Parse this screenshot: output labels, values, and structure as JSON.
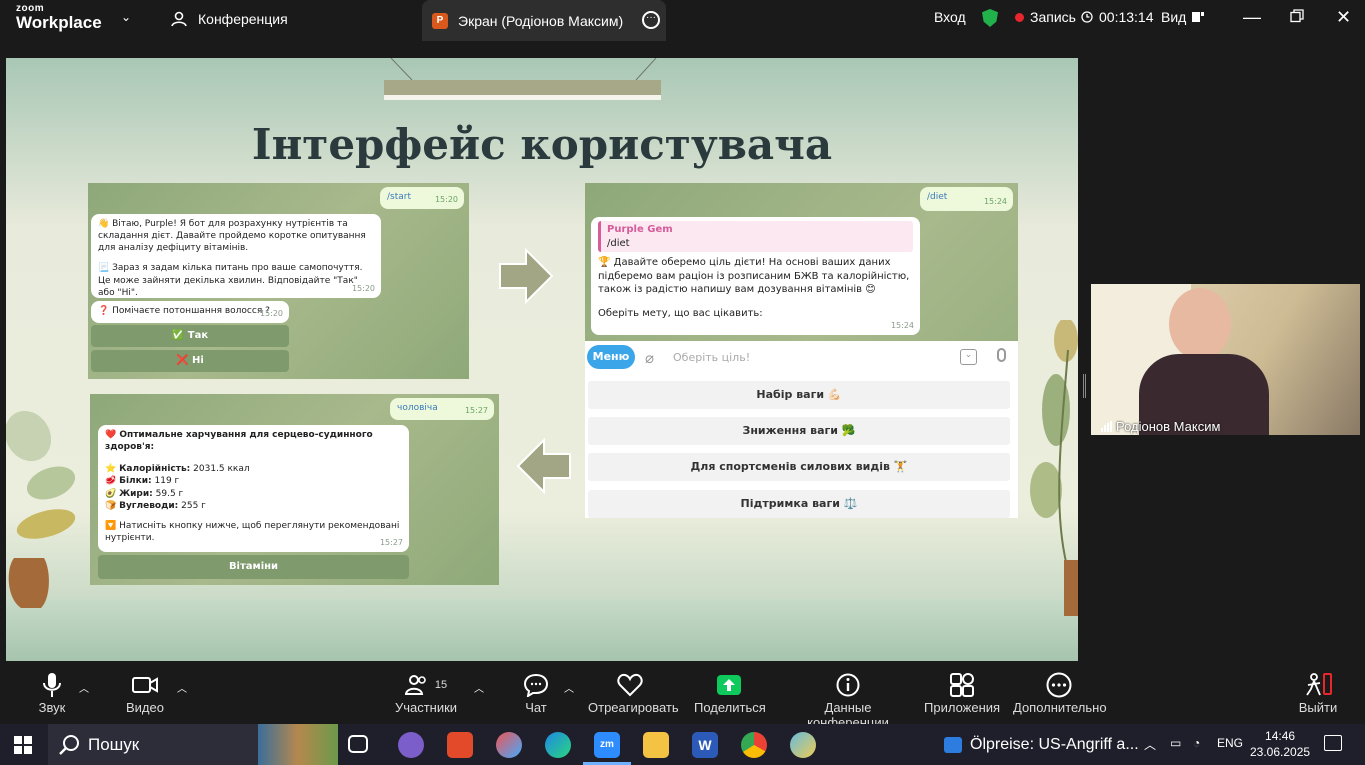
{
  "titlebar": {
    "brand_small": "zoom",
    "brand_big": "Workplace",
    "conference_label": "Конференция",
    "tab_badge": "P",
    "tab_label": "Экран (Родіонов Максим)",
    "login_label": "Вход",
    "record_label": "Запись",
    "timer": "00:13:14",
    "view_label": "Вид"
  },
  "slide": {
    "title": "Інтерфейс користувача",
    "panel1": {
      "cmd": "/start",
      "cmd_time": "15:20",
      "msg1": "👋 Вітаю, Purple! Я бот для розрахунку нутрієнтів та складання дієт. Давайте пройдемо коротке опитування для аналізу дефіциту вітамінів.",
      "msg2": "📃 Зараз я задам кілька питань про ваше самопочуття. Це може зайняти декілька хвилин. Відповідайте \"Так\" або \"Ні\".",
      "msg_time": "15:20",
      "question": "❓ Помічаєте потоншання волосся ?",
      "question_time": "15:20",
      "yes": "✅ Так",
      "no": "❌ Ні"
    },
    "panel2": {
      "cmd": "/diet",
      "cmd_time": "15:24",
      "reply_name": "Purple Gem",
      "reply_text": "/diet",
      "msg": "🏆 Давайте оберемо ціль дієти! На основі ваших даних підберемо вам раціон із розписаним БЖВ та калорійністю, також із радістю напишу вам дозування вітамінів 😊",
      "msg2": "Оберіть мету, що вас цікавить:",
      "msg_time": "15:24",
      "menu_label": "Меню",
      "input_placeholder": "Оберіть ціль!",
      "options": [
        "Набір ваги 💪🏻",
        "Зниження ваги 🥦",
        "Для спортсменів силових видів 🏋️",
        "Підтримка ваги ⚖️"
      ]
    },
    "panel3": {
      "cmd": "чоловіча",
      "cmd_time": "15:27",
      "heading": "❤️ Оптимальне харчування для серцево-судинного здоров'я:",
      "cal_label": "Калорійність:",
      "cal_value": "2031.5 ккал",
      "prot_label": "Білки:",
      "prot_value": "119 г",
      "fat_label": "Жири:",
      "fat_value": "59.5 г",
      "carb_label": "Вуглеводи:",
      "carb_value": "255 г",
      "footer": "🔽 Натисніть кнопку нижче, щоб переглянути рекомендовані нутрієнти.",
      "msg_time": "15:27",
      "button": "Вітаміни"
    }
  },
  "video": {
    "participant_name": "Родіонов Максим"
  },
  "toolbar": {
    "audio": "Звук",
    "video": "Видео",
    "participants": "Участники",
    "participants_count": "15",
    "chat": "Чат",
    "react": "Отреагировать",
    "share": "Поделиться",
    "info": "Данные конференции",
    "apps": "Приложения",
    "more": "Дополнительно",
    "leave": "Выйти"
  },
  "taskbar": {
    "search": "Пошук",
    "news": "Ölpreise: US-Angriff a...",
    "lang": "ENG",
    "time": "14:46",
    "date": "23.06.2025"
  },
  "colors": {
    "accent_green": "#22b24c",
    "record_red": "#e8262d",
    "share_green": "#0ec95b",
    "telegram_blue": "#3aa5e9"
  }
}
